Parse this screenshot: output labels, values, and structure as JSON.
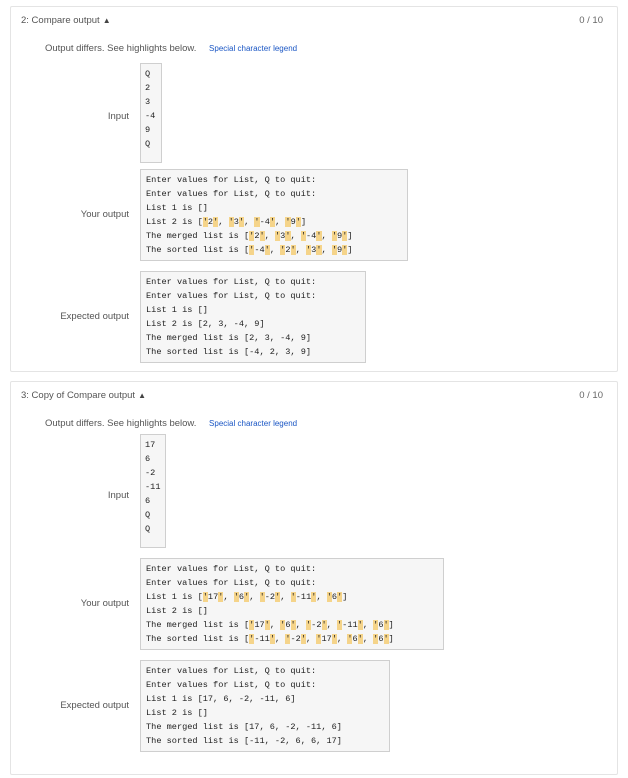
{
  "cards": [
    {
      "title": "2: Compare output",
      "score": "0 / 10",
      "differs_text": "Output differs. See highlights below.",
      "legend_link": "Special character legend",
      "input_label": "Input",
      "input_lines": [
        "Q",
        "2",
        "3",
        "-4",
        "9",
        "Q"
      ],
      "your_label": "Your output",
      "your_lines": [
        "Enter values for List, Q to quit:",
        "Enter values for List, Q to quit:",
        "List 1 is []",
        "List 2 is ['2', '3', '-4', '9']",
        "The merged list is ['2', '3', '-4', '9']",
        "The sorted list is ['-4', '2', '3', '9']"
      ],
      "expected_label": "Expected output",
      "expected_lines": [
        "Enter values for List, Q to quit:",
        "Enter values for List, Q to quit:",
        "List 1 is []",
        "List 2 is [2, 3, -4, 9]",
        "The merged list is [2, 3, -4, 9]",
        "The sorted list is [-4, 2, 3, 9]"
      ]
    },
    {
      "title": "3: Copy of Compare output",
      "score": "0 / 10",
      "differs_text": "Output differs. See highlights below.",
      "legend_link": "Special character legend",
      "input_label": "Input",
      "input_lines": [
        "17",
        "6",
        "-2",
        "-11",
        "6",
        "Q",
        "Q"
      ],
      "your_label": "Your output",
      "your_lines": [
        "Enter values for List, Q to quit:",
        "Enter values for List, Q to quit:",
        "List 1 is ['17', '6', '-2', '-11', '6']",
        "List 2 is []",
        "The merged list is ['17', '6', '-2', '-11', '6']",
        "The sorted list is ['-11', '-2', '17', '6', '6']"
      ],
      "expected_label": "Expected output",
      "expected_lines": [
        "Enter values for List, Q to quit:",
        "Enter values for List, Q to quit:",
        "List 1 is [17, 6, -2, -11, 6]",
        "List 2 is []",
        "The merged list is [17, 6, -2, -11, 6]",
        "The sorted list is [-11, -2, 6, 6, 17]"
      ]
    }
  ],
  "colors": {
    "highlight": "#f5d48a",
    "link": "#1a56c4"
  },
  "icons": {
    "collapse": "chevron-up-icon"
  }
}
